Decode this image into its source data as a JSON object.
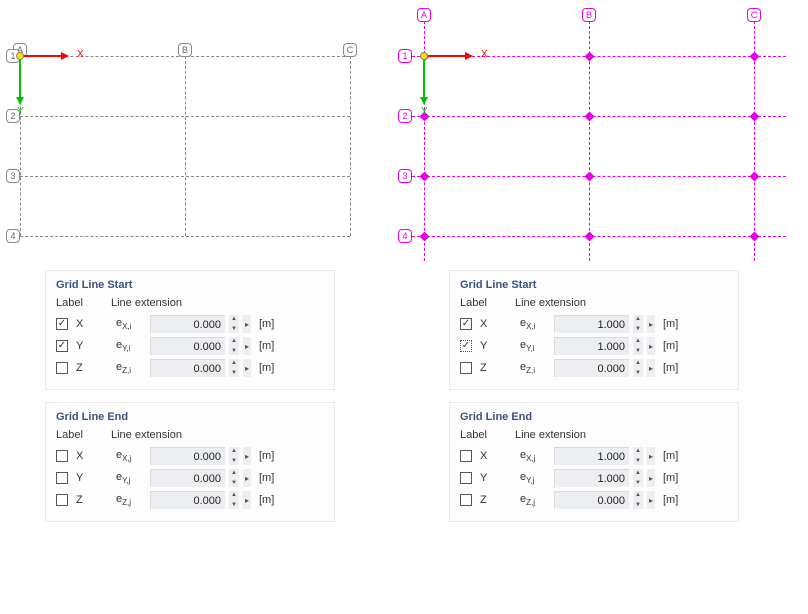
{
  "grid": {
    "col_labels": [
      "A",
      "B",
      "C"
    ],
    "row_labels": [
      "1",
      "2",
      "3",
      "4"
    ],
    "axis_x": "X",
    "axis_y": "Y"
  },
  "unit": "[m]",
  "headers": {
    "label": "Label",
    "lineext": "Line extension"
  },
  "left": {
    "start": {
      "title": "Grid Line Start",
      "rows": [
        {
          "axis": "X",
          "checked": true,
          "param": "e<sub>X,i</sub>",
          "value": "0.000"
        },
        {
          "axis": "Y",
          "checked": true,
          "param": "e<sub>Y,i</sub>",
          "value": "0.000"
        },
        {
          "axis": "Z",
          "checked": false,
          "param": "e<sub>Z,i</sub>",
          "value": "0.000"
        }
      ]
    },
    "end": {
      "title": "Grid Line End",
      "rows": [
        {
          "axis": "X",
          "checked": false,
          "param": "e<sub>X,j</sub>",
          "value": "0.000"
        },
        {
          "axis": "Y",
          "checked": false,
          "param": "e<sub>Y,j</sub>",
          "value": "0.000"
        },
        {
          "axis": "Z",
          "checked": false,
          "param": "e<sub>Z,j</sub>",
          "value": "0.000"
        }
      ]
    }
  },
  "right": {
    "start": {
      "title": "Grid Line Start",
      "rows": [
        {
          "axis": "X",
          "checked": true,
          "param": "e<sub>X,i</sub>",
          "value": "1.000"
        },
        {
          "axis": "Y",
          "checked": true,
          "dotted": true,
          "param": "e<sub>Y,i</sub>",
          "value": "1.000"
        },
        {
          "axis": "Z",
          "checked": false,
          "param": "e<sub>Z,i</sub>",
          "value": "0.000"
        }
      ]
    },
    "end": {
      "title": "Grid Line End",
      "rows": [
        {
          "axis": "X",
          "checked": false,
          "param": "e<sub>X,j</sub>",
          "value": "1.000"
        },
        {
          "axis": "Y",
          "checked": false,
          "param": "e<sub>Y,j</sub>",
          "value": "1.000"
        },
        {
          "axis": "Z",
          "checked": false,
          "param": "e<sub>Z,j</sub>",
          "value": "0.000"
        }
      ]
    }
  },
  "grid_layout": {
    "col_x": [
      0,
      165,
      330
    ],
    "row_y": [
      0,
      60,
      120,
      180
    ]
  }
}
